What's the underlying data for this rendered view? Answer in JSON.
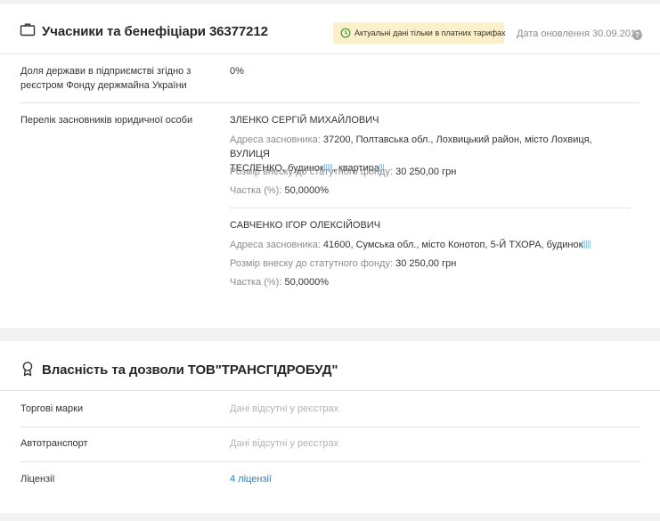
{
  "participants": {
    "title": "Учасники та бенефіціари 36377212",
    "notice": "Актуальні дані тільки в платних тарифах",
    "update_date": "Дата оновлення 30.09.2019",
    "help": "?",
    "state_share_label": "Доля держави в підприємстві згідно з реєстром Фонду держмайна України",
    "state_share_value": "0%",
    "founders_label": "Перелік засновників юридичної особи",
    "founders": [
      {
        "name": "ЗЛЕНКО СЕРГІЙ МИХАЙЛОВИЧ",
        "address_label": "Адреса засновника:",
        "address_line1": "37200, Полтавська обл., Лохвицький район, місто Лохвиця, ВУЛИЦЯ",
        "address_line2a": "ТЕСЛЕНКО, будинок",
        "address_line2b": ", квартира",
        "contribution_label": "Розмір внеску до статутного фонду:",
        "contribution_value": "30 250,00 грн",
        "share_label": "Частка (%):",
        "share_value": "50,0000%"
      },
      {
        "name": "САВЧЕНКО ІГОР ОЛЕКСІЙОВИЧ",
        "address_label": "Адреса засновника:",
        "address_line1": "41600, Сумська обл., місто Конотоп, 5-Й ТХОРА, будинок",
        "contribution_label": "Розмір внеску до статутного фонду:",
        "contribution_value": "30 250,00 грн",
        "share_label": "Частка (%):",
        "share_value": "50,0000%"
      }
    ]
  },
  "ownership": {
    "title": "Власність та дозволи ТОВ\"ТРАНСГІДРОБУД\"",
    "rows": [
      {
        "label": "Торгові марки",
        "value": "Дані відсутні у реєстрах"
      },
      {
        "label": "Автотранспорт",
        "value": "Дані відсутні у реєстрах"
      },
      {
        "label": "Ліцензії",
        "value": "4 ліцензії"
      }
    ]
  },
  "icons": {
    "briefcase": "briefcase-icon",
    "clock": "clock-icon",
    "award": "award-icon",
    "masked": "masked-data-icon"
  },
  "colors": {
    "notice_bg": "#fbf0c9",
    "link": "#2a7dc0",
    "notice_icon": "#3a9a3a"
  }
}
